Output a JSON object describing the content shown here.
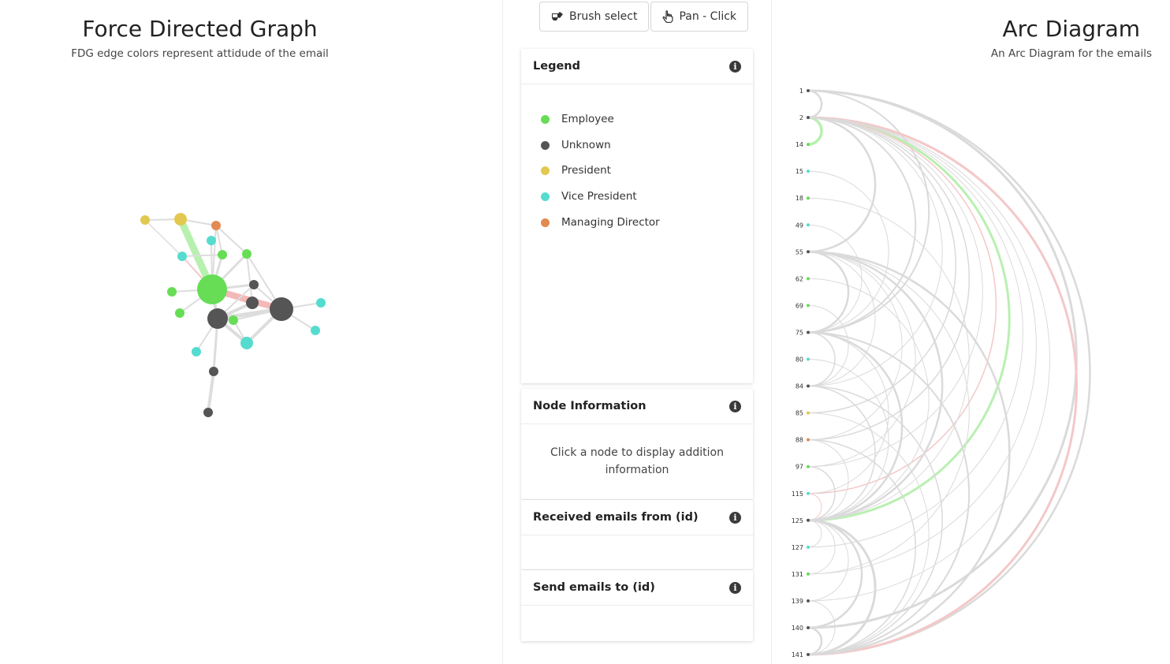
{
  "fdg": {
    "title": "Force Directed Graph",
    "subtitle": "FDG edge colors represent attidude of the email"
  },
  "toolbar": {
    "brush_label": "Brush select",
    "pan_label": "Pan - Click"
  },
  "legend": {
    "title": "Legend",
    "items": [
      {
        "label": "Employee",
        "color": "#66dd55"
      },
      {
        "label": "Unknown",
        "color": "#555555"
      },
      {
        "label": "President",
        "color": "#e2c84f"
      },
      {
        "label": "Vice President",
        "color": "#55dccf"
      },
      {
        "label": "Managing Director",
        "color": "#e28a50"
      }
    ]
  },
  "node_info": {
    "title": "Node Information",
    "message": "Click a node to display addition information"
  },
  "received": {
    "title": "Received emails from (id)"
  },
  "sent": {
    "title": "Send emails to (id)"
  },
  "arc": {
    "title": "Arc Diagram",
    "subtitle": "An Arc Diagram for the emails",
    "nodes": [
      {
        "id": "1",
        "color": "#555555"
      },
      {
        "id": "2",
        "color": "#555555"
      },
      {
        "id": "14",
        "color": "#66dd55"
      },
      {
        "id": "15",
        "color": "#55dccf"
      },
      {
        "id": "18",
        "color": "#66dd55"
      },
      {
        "id": "49",
        "color": "#55dccf"
      },
      {
        "id": "55",
        "color": "#555555"
      },
      {
        "id": "62",
        "color": "#66dd55"
      },
      {
        "id": "69",
        "color": "#66dd55"
      },
      {
        "id": "75",
        "color": "#555555"
      },
      {
        "id": "80",
        "color": "#55dccf"
      },
      {
        "id": "84",
        "color": "#555555"
      },
      {
        "id": "85",
        "color": "#e2c84f"
      },
      {
        "id": "88",
        "color": "#e28a50"
      },
      {
        "id": "97",
        "color": "#66dd55"
      },
      {
        "id": "115",
        "color": "#55dccf"
      },
      {
        "id": "125",
        "color": "#555555"
      },
      {
        "id": "127",
        "color": "#55dccf"
      },
      {
        "id": "131",
        "color": "#66dd55"
      },
      {
        "id": "139",
        "color": "#555555"
      },
      {
        "id": "140",
        "color": "#555555"
      },
      {
        "id": "141",
        "color": "#555555"
      }
    ]
  }
}
